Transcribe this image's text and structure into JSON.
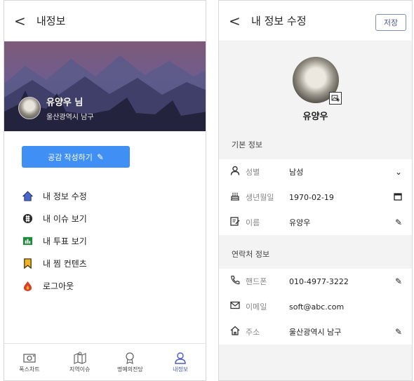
{
  "left": {
    "header": {
      "back": "<",
      "title": "내정보"
    },
    "profile": {
      "name": "유양우 님",
      "location": "울산광역시 남구"
    },
    "write_button": {
      "label": "공감 작성하기",
      "icon": "pencil-icon"
    },
    "menu": [
      {
        "label": "내 정보 수정",
        "icon": "home-icon"
      },
      {
        "label": "내 이슈 보기",
        "icon": "issue-icon"
      },
      {
        "label": "내 투표 보기",
        "icon": "chart-icon"
      },
      {
        "label": "내 찜 컨텐츠",
        "icon": "bookmark-icon"
      },
      {
        "label": "로그아웃",
        "icon": "logout-icon"
      }
    ],
    "bottom_nav": [
      {
        "label": "폭스차트",
        "icon": "camera-icon",
        "active": false
      },
      {
        "label": "지역이슈",
        "icon": "map-icon",
        "active": false
      },
      {
        "label": "명예의전당",
        "icon": "medal-icon",
        "active": false
      },
      {
        "label": "내정보",
        "icon": "user-icon",
        "active": true
      }
    ]
  },
  "right": {
    "header": {
      "back": "<",
      "title": "내 정보 수정",
      "save": "저장"
    },
    "profile": {
      "name": "유양우"
    },
    "basic_section": "기본 정보",
    "basic_rows": [
      {
        "icon": "person-icon",
        "label": "성별",
        "value": "남성",
        "action": "chevron-down-icon"
      },
      {
        "icon": "cake-icon",
        "label": "생년월일",
        "value": "1970-02-19",
        "action": "calendar-icon"
      },
      {
        "icon": "edit-box-icon",
        "label": "이름",
        "value": "유양우",
        "action": "pencil-icon"
      }
    ],
    "contact_section": "연락처 정보",
    "contact_rows": [
      {
        "icon": "phone-icon",
        "label": "핸드폰",
        "value": "010-4977-3222",
        "action": "pencil-icon"
      },
      {
        "icon": "mail-icon",
        "label": "이메일",
        "value": "soft@abc.com",
        "action": ""
      },
      {
        "icon": "home-icon",
        "label": "주소",
        "value": "울산광역시 남구",
        "action": "pencil-icon"
      }
    ]
  },
  "colors": {
    "accent": "#3f8ff5",
    "nav_active": "#4b5bc6",
    "hero_dark": "#2a2a48"
  }
}
